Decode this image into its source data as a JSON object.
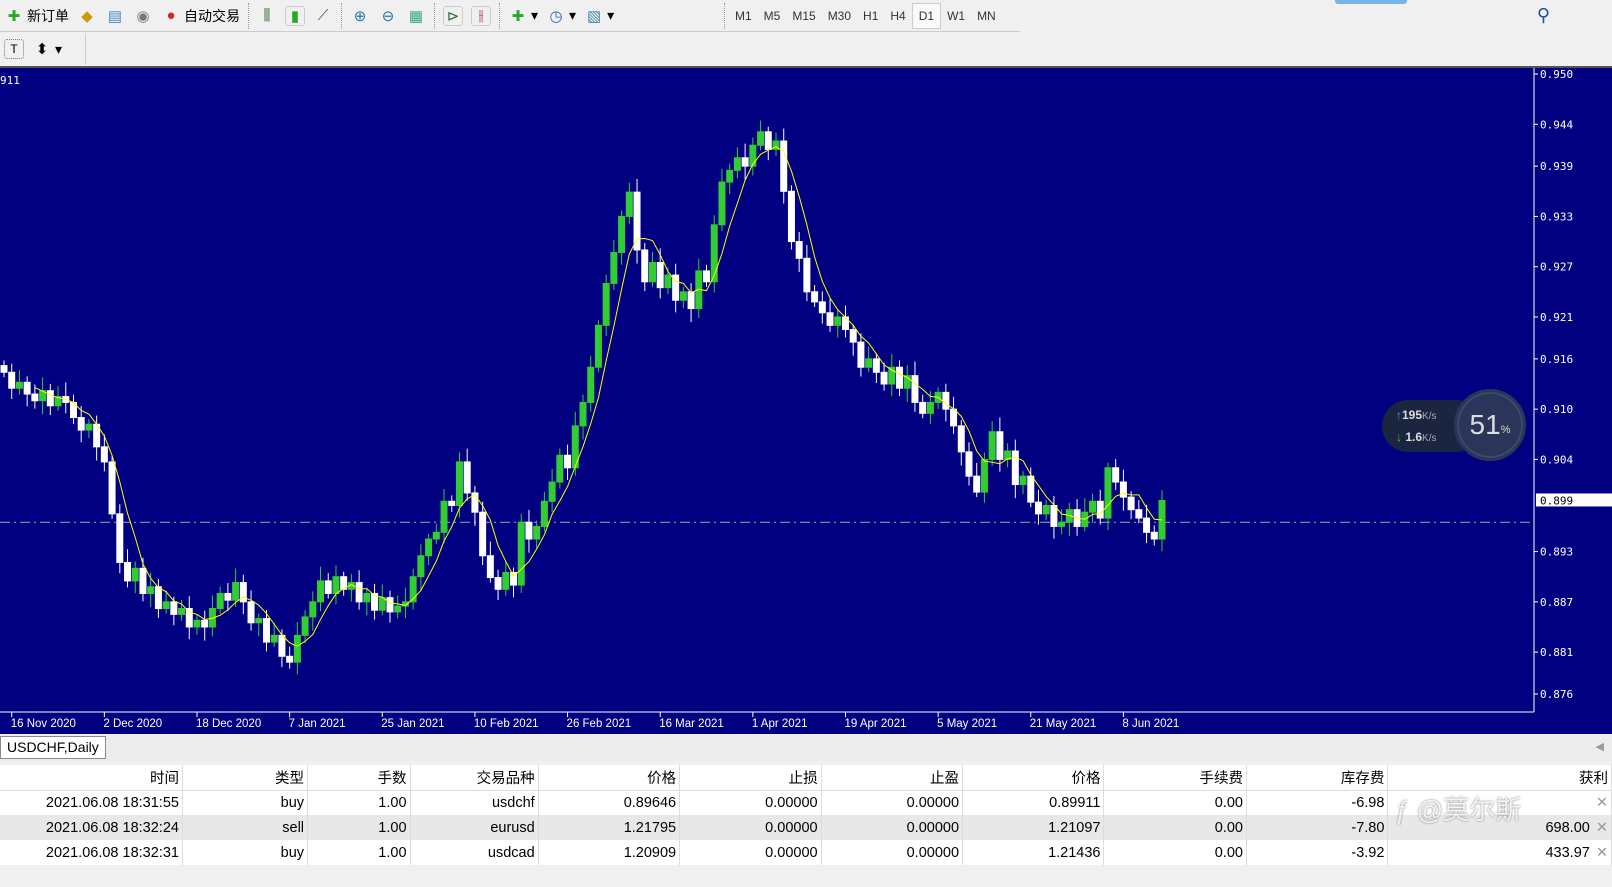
{
  "toolbar": {
    "new_order": "新订单",
    "auto_trading": "自动交易",
    "timeframes": [
      "M1",
      "M5",
      "M15",
      "M30",
      "H1",
      "H4",
      "D1",
      "W1",
      "MN"
    ],
    "active_timeframe": "D1"
  },
  "chart": {
    "top_left_label": "911",
    "symbol_tab": "USDCHF,Daily",
    "price_axis": [
      "0.950",
      "0.944",
      "0.939",
      "0.933",
      "0.927",
      "0.921",
      "0.916",
      "0.910",
      "0.904",
      "0.893",
      "0.887",
      "0.881",
      "0.876"
    ],
    "current_price_label": "0.899",
    "current_price": 0.8991,
    "ask_line": 0.8965,
    "date_labels": [
      "16 Nov 2020",
      "2 Dec 2020",
      "18 Dec 2020",
      "7 Jan 2021",
      "25 Jan 2021",
      "10 Feb 2021",
      "26 Feb 2021",
      "16 Mar 2021",
      "1 Apr 2021",
      "19 Apr 2021",
      "5 May 2021",
      "21 May 2021",
      "8 Jun 2021"
    ],
    "colors": {
      "background": "#000080",
      "bull": "#32cd32",
      "bear": "#ffffff",
      "ma": "#ffff00",
      "axis": "#ffffff"
    }
  },
  "chart_data": {
    "type": "candlestick",
    "symbol": "USDCHF",
    "timeframe": "Daily",
    "ylim": [
      0.876,
      0.95
    ],
    "ma_period": 5,
    "closes": [
      0.9144,
      0.9125,
      0.9132,
      0.9118,
      0.911,
      0.9122,
      0.9104,
      0.9115,
      0.9108,
      0.909,
      0.9075,
      0.9082,
      0.9055,
      0.9037,
      0.8975,
      0.8917,
      0.8895,
      0.891,
      0.888,
      0.8888,
      0.8862,
      0.887,
      0.8855,
      0.8862,
      0.884,
      0.8848,
      0.884,
      0.8862,
      0.888,
      0.8872,
      0.8893,
      0.887,
      0.8845,
      0.885,
      0.8822,
      0.883,
      0.8805,
      0.8798,
      0.883,
      0.8852,
      0.887,
      0.8895,
      0.888,
      0.89,
      0.8885,
      0.8893,
      0.887,
      0.888,
      0.886,
      0.8875,
      0.8858,
      0.8865,
      0.887,
      0.89,
      0.8925,
      0.8945,
      0.8953,
      0.899,
      0.8985,
      0.9037,
      0.9,
      0.8977,
      0.8925,
      0.8899,
      0.8885,
      0.8905,
      0.889,
      0.8965,
      0.8945,
      0.896,
      0.899,
      0.9013,
      0.9045,
      0.903,
      0.908,
      0.9108,
      0.915,
      0.92,
      0.925,
      0.9287,
      0.933,
      0.9359,
      0.929,
      0.9252,
      0.9275,
      0.9245,
      0.926,
      0.923,
      0.924,
      0.922,
      0.9265,
      0.9252,
      0.932,
      0.9371,
      0.9385,
      0.94,
      0.939,
      0.9415,
      0.9431,
      0.941,
      0.942,
      0.936,
      0.93,
      0.928,
      0.924,
      0.9228,
      0.9215,
      0.92,
      0.921,
      0.9195,
      0.918,
      0.915,
      0.916,
      0.9144,
      0.913,
      0.915,
      0.9125,
      0.914,
      0.9108,
      0.9095,
      0.9108,
      0.912,
      0.91,
      0.908,
      0.9049,
      0.902,
      0.9001,
      0.904,
      0.9073,
      0.904,
      0.905,
      0.901,
      0.902,
      0.8989,
      0.8975,
      0.8985,
      0.896,
      0.8965,
      0.898,
      0.896,
      0.8977,
      0.899,
      0.897,
      0.903,
      0.9013,
      0.8995,
      0.898,
      0.897,
      0.8953,
      0.8945,
      0.8991
    ]
  },
  "network": {
    "up": "195",
    "down": "1.6",
    "unit": "K/s",
    "cpu": "51",
    "pct": "%"
  },
  "trades": {
    "headers": [
      "时间",
      "类型",
      "手数",
      "交易品种",
      "价格",
      "止损",
      "止盈",
      "价格",
      "手续费",
      "库存费",
      "获利"
    ],
    "rows": [
      [
        "2021.06.08 18:31:55",
        "buy",
        "1.00",
        "usdchf",
        "0.89646",
        "0.00000",
        "0.00000",
        "0.89911",
        "0.00",
        "-6.98",
        ""
      ],
      [
        "2021.06.08 18:32:24",
        "sell",
        "1.00",
        "eurusd",
        "1.21795",
        "0.00000",
        "0.00000",
        "1.21097",
        "0.00",
        "-7.80",
        "698.00"
      ],
      [
        "2021.06.08 18:32:31",
        "buy",
        "1.00",
        "usdcad",
        "1.20909",
        "0.00000",
        "0.00000",
        "1.21436",
        "0.00",
        "-3.92",
        "433.97"
      ]
    ]
  },
  "watermark": "@莫尔斯"
}
